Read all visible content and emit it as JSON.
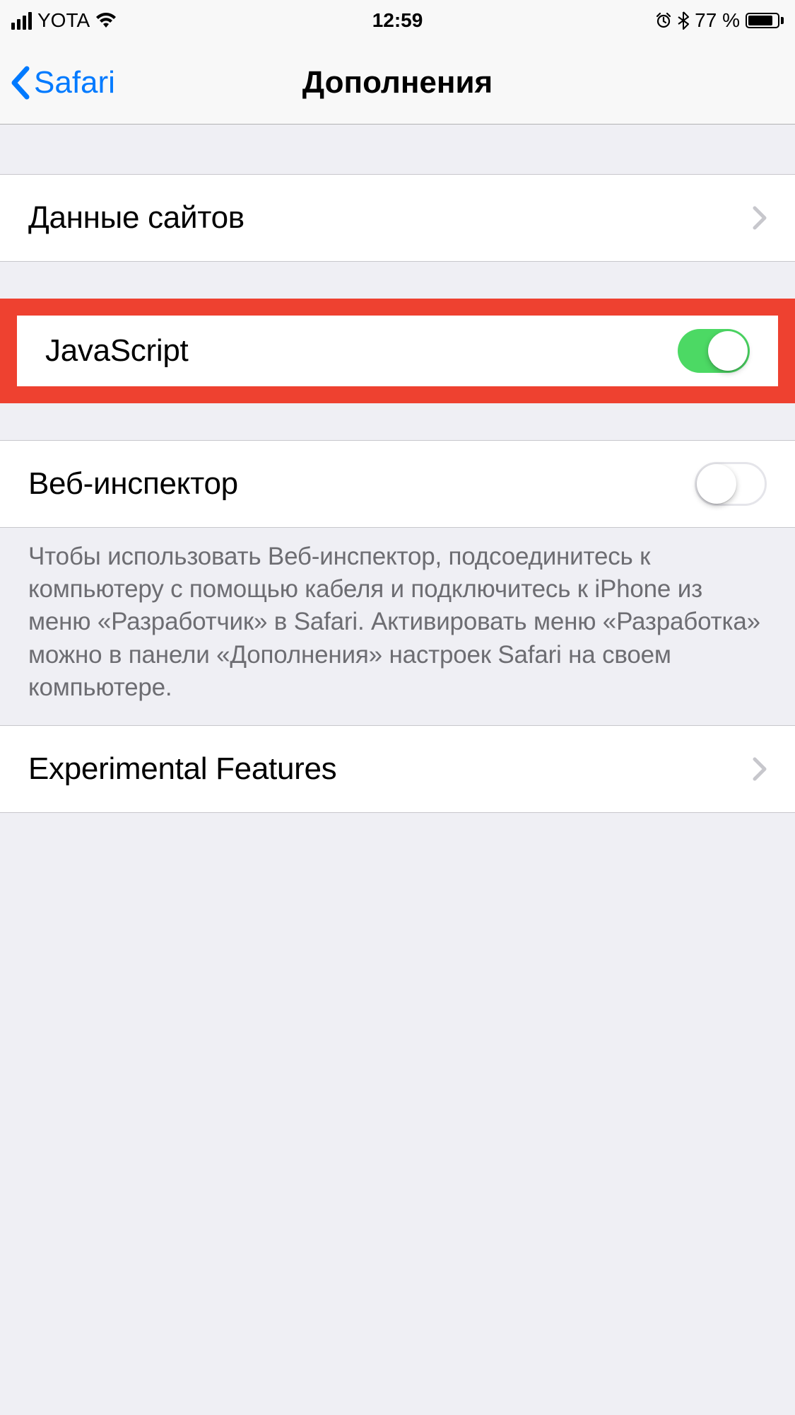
{
  "status": {
    "carrier": "YOTA",
    "time": "12:59",
    "battery_pct": "77 %"
  },
  "nav": {
    "back_label": "Safari",
    "title": "Дополнения"
  },
  "rows": {
    "website_data": "Данные сайтов",
    "javascript": "JavaScript",
    "web_inspector": "Веб-инспектор",
    "experimental": "Experimental Features"
  },
  "footer": {
    "web_inspector_help": "Чтобы использовать Веб-инспектор, подсоединитесь к компьютеру с помощью кабеля и подключитесь к iPhone из меню «Разработчик» в Safari. Активировать меню «Разработка» можно в панели «Дополнения» настроек Safari на своем компьютере."
  },
  "toggles": {
    "javascript_on": true,
    "web_inspector_on": false
  },
  "colors": {
    "highlight": "#ee4130",
    "tint": "#007aff",
    "switch_on": "#4cd964"
  }
}
